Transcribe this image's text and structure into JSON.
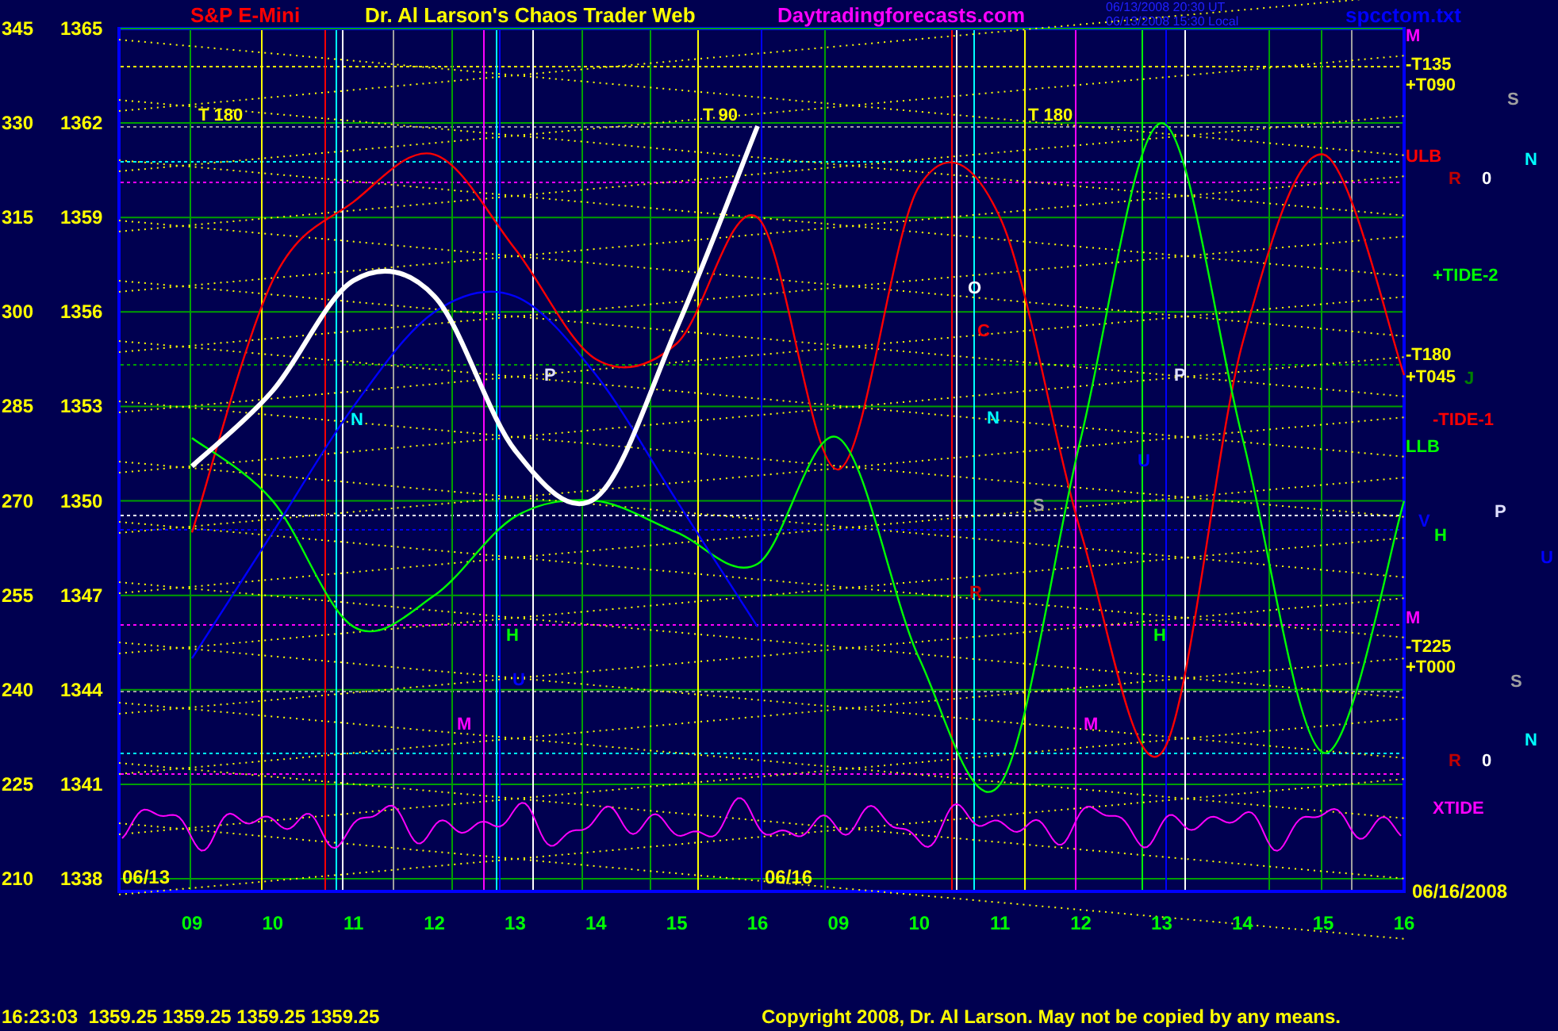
{
  "header": {
    "symbol": "S&P E-Mini",
    "title": "Dr. Al Larson's Chaos Trader Web",
    "site": "Daytradingforecasts.com",
    "timestamps": [
      "06/13/2008 20:30 UT",
      "06/13/2008 15:30 Local"
    ],
    "file": "spcctom.txt"
  },
  "chart": {
    "left_scale": [
      "345",
      "330",
      "315",
      "300",
      "285",
      "270",
      "255",
      "240",
      "225",
      "210"
    ],
    "chart_data": {
      "type": "line",
      "ylim": [
        1337.6,
        1365
      ],
      "yticks": [
        1365,
        1362,
        1359,
        1356,
        1353,
        1350,
        1347,
        1344,
        1341,
        1338
      ],
      "categories": [
        "09",
        "10",
        "11",
        "12",
        "13",
        "14",
        "15",
        "16",
        "09",
        "10",
        "11",
        "12",
        "13",
        "14",
        "15",
        "16"
      ],
      "series": [
        {
          "color": "#ff0000",
          "values": [
            1349,
            1357,
            1359.5,
            1361,
            1358,
            1354.5,
            1355,
            1359,
            1351,
            1360,
            1359,
            1349,
            1342,
            1355,
            1361,
            1354
          ]
        },
        {
          "color": "#00ff00",
          "values": [
            1352,
            1350,
            1346,
            1347,
            1349.5,
            1350,
            1349,
            1348,
            1352,
            1345,
            1341,
            1352,
            1362,
            1352,
            1342,
            1350
          ]
        },
        {
          "color": "#0000ff",
          "values": [
            1345,
            1349,
            1353,
            1356,
            1356.5,
            1354,
            1350,
            1346,
            null,
            null,
            null,
            null,
            null,
            null,
            null,
            null
          ]
        },
        {
          "color": "#ffffff",
          "values": [
            1351.1,
            1353.5,
            1357,
            1356.5,
            1351.6,
            1350.1,
            1355.5,
            1361.9,
            null,
            null,
            null,
            null,
            null,
            null,
            null,
            null
          ]
        }
      ]
    }
  },
  "plot_labels": [
    {
      "text": "T 180",
      "color": "#ffff00"
    },
    {
      "text": "T 90",
      "color": "#ffff00"
    },
    {
      "text": "T 180",
      "color": "#ffff00"
    },
    {
      "text": "N",
      "color": "#00ffff"
    },
    {
      "text": "P",
      "color": "#e0e0ff"
    },
    {
      "text": "H",
      "color": "#00ff00"
    },
    {
      "text": "U",
      "color": "#0000ff"
    },
    {
      "text": "M",
      "color": "#ff00ff"
    },
    {
      "text": "O",
      "color": "#ffffff"
    },
    {
      "text": "C",
      "color": "#ff0000"
    },
    {
      "text": "N",
      "color": "#00ffff"
    },
    {
      "text": "P",
      "color": "#e0e0ff"
    },
    {
      "text": "S",
      "color": "#a0a0a0"
    },
    {
      "text": "U",
      "color": "#0000ff"
    },
    {
      "text": "R",
      "color": "#c00000"
    },
    {
      "text": "H",
      "color": "#00ff00"
    },
    {
      "text": "M",
      "color": "#ff00ff"
    }
  ],
  "date_labels": [
    "06/13",
    "06/16",
    "06/16/2008"
  ],
  "right_labels": [
    {
      "text": "M",
      "color": "#ff00ff"
    },
    {
      "text": "-T135",
      "color": "#ffff00"
    },
    {
      "text": "+T090",
      "color": "#ffff00"
    },
    {
      "text": "S",
      "color": "#a0a0a0"
    },
    {
      "text": "N",
      "color": "#00ffff"
    },
    {
      "text": "ULB",
      "color": "#ff0000"
    },
    {
      "text": "R",
      "color": "#c00000"
    },
    {
      "text": "0",
      "color": "#ffffff"
    },
    {
      "text": "+TIDE-2",
      "color": "#00ff00"
    },
    {
      "text": "-T180",
      "color": "#ffff00"
    },
    {
      "text": "+T045",
      "color": "#ffff00"
    },
    {
      "text": "J",
      "color": "#008000"
    },
    {
      "text": "-TIDE-1",
      "color": "#ff0000"
    },
    {
      "text": "LLB",
      "color": "#00ff00"
    },
    {
      "text": "V",
      "color": "#0000ff"
    },
    {
      "text": "P",
      "color": "#e0e0ff"
    },
    {
      "text": "H",
      "color": "#00ff00"
    },
    {
      "text": "U",
      "color": "#0000ff"
    },
    {
      "text": "M",
      "color": "#ff00ff"
    },
    {
      "text": "-T225",
      "color": "#ffff00"
    },
    {
      "text": "+T000",
      "color": "#ffff00"
    },
    {
      "text": "S",
      "color": "#a0a0a0"
    },
    {
      "text": "N",
      "color": "#00ffff"
    },
    {
      "text": "R",
      "color": "#c00000"
    },
    {
      "text": "0",
      "color": "#ffffff"
    },
    {
      "text": "XTIDE",
      "color": "#ff00ff"
    }
  ],
  "status_bar": {
    "quote": "16:23:03  1359.25 1359.25 1359.25 1359.25",
    "copyright": "Copyright 2008, Dr. Al Larson. May not be copied by any means."
  }
}
